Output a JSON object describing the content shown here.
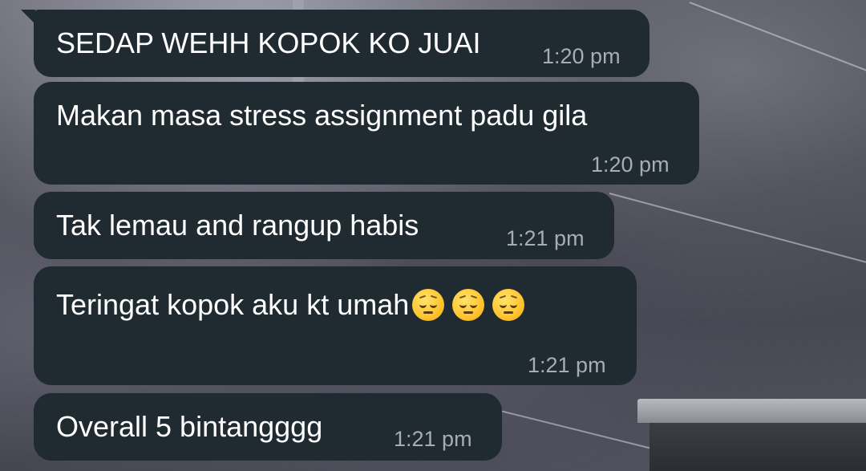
{
  "messages": [
    {
      "text": "SEDAP WEHH KOPOK KO JUAI",
      "time": "1:20 pm"
    },
    {
      "text": "Makan masa stress assignment padu gila",
      "time": "1:20 pm"
    },
    {
      "text": "Tak lemau and rangup habis",
      "time": "1:21 pm"
    },
    {
      "text": "Teringat kopok aku kt umah",
      "emoji": [
        "pensive-face",
        "pensive-face",
        "pensive-face"
      ],
      "time": "1:21 pm"
    },
    {
      "text": "Overall 5 bintangggg",
      "time": "1:21 pm"
    }
  ],
  "colors": {
    "bubble": "#1f2a31",
    "message_text": "#ffffff",
    "timestamp": "#a7adb2"
  }
}
